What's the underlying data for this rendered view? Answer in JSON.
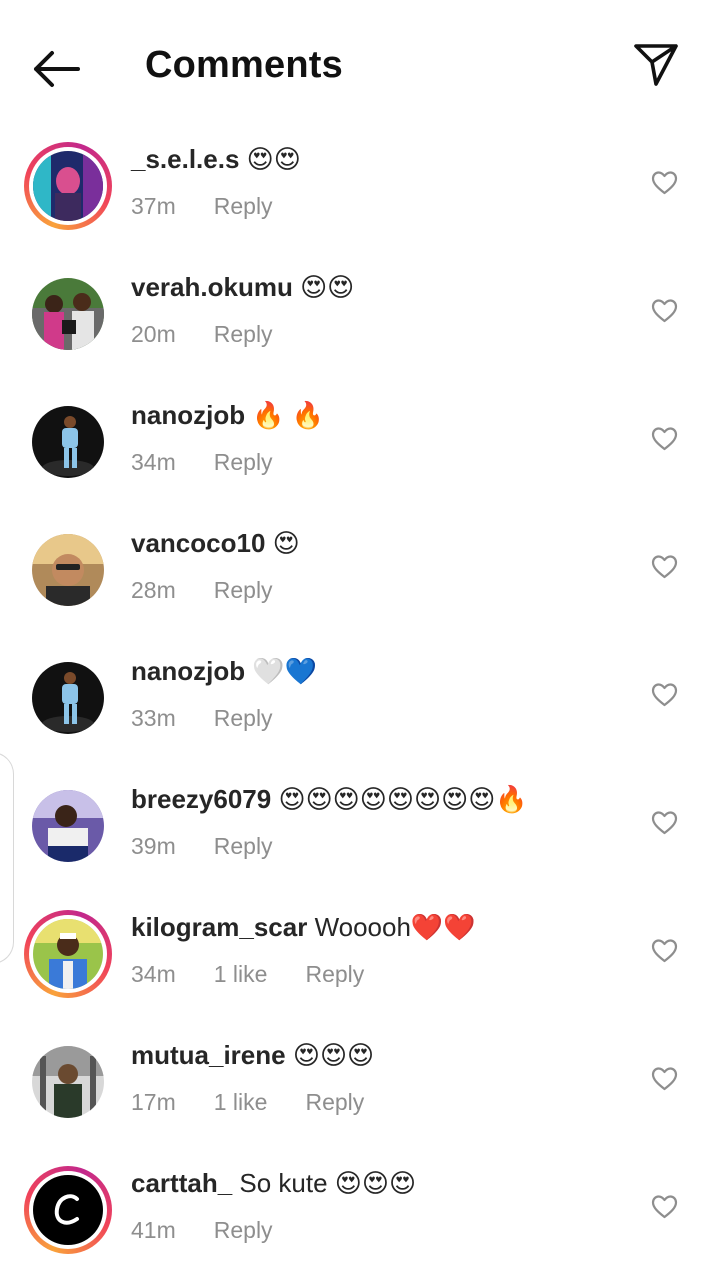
{
  "header": {
    "title": "Comments"
  },
  "icons": {
    "back": "arrow-left-icon",
    "share": "paper-plane-icon",
    "like": "heart-outline-icon"
  },
  "comments": [
    {
      "user": "_s.e.l.e.s",
      "text": "😍😍",
      "time": "37m",
      "likes": "",
      "reply": "Reply",
      "ring": true
    },
    {
      "user": "verah.okumu",
      "text": "😍😍",
      "time": "20m",
      "likes": "",
      "reply": "Reply",
      "ring": false
    },
    {
      "user": "nanozjob",
      "text": "🔥 🔥",
      "time": "34m",
      "likes": "",
      "reply": "Reply",
      "ring": false
    },
    {
      "user": "vancoco10",
      "text": "😍",
      "time": "28m",
      "likes": "",
      "reply": "Reply",
      "ring": false
    },
    {
      "user": "nanozjob",
      "text": "🤍💙",
      "time": "33m",
      "likes": "",
      "reply": "Reply",
      "ring": false
    },
    {
      "user": "breezy6079",
      "text": "😍😍😍😍😍😍😍😍🔥",
      "time": "39m",
      "likes": "",
      "reply": "Reply",
      "ring": false
    },
    {
      "user": "kilogram_scar",
      "text": "Wooooh❤️❤️",
      "time": "34m",
      "likes": "1 like",
      "reply": "Reply",
      "ring": true
    },
    {
      "user": "mutua_irene",
      "text": "😍😍😍",
      "time": "17m",
      "likes": "1 like",
      "reply": "Reply",
      "ring": false
    },
    {
      "user": "carttah_",
      "text": "So kute 😍😍😍",
      "time": "41m",
      "likes": "",
      "reply": "Reply",
      "ring": true
    }
  ]
}
